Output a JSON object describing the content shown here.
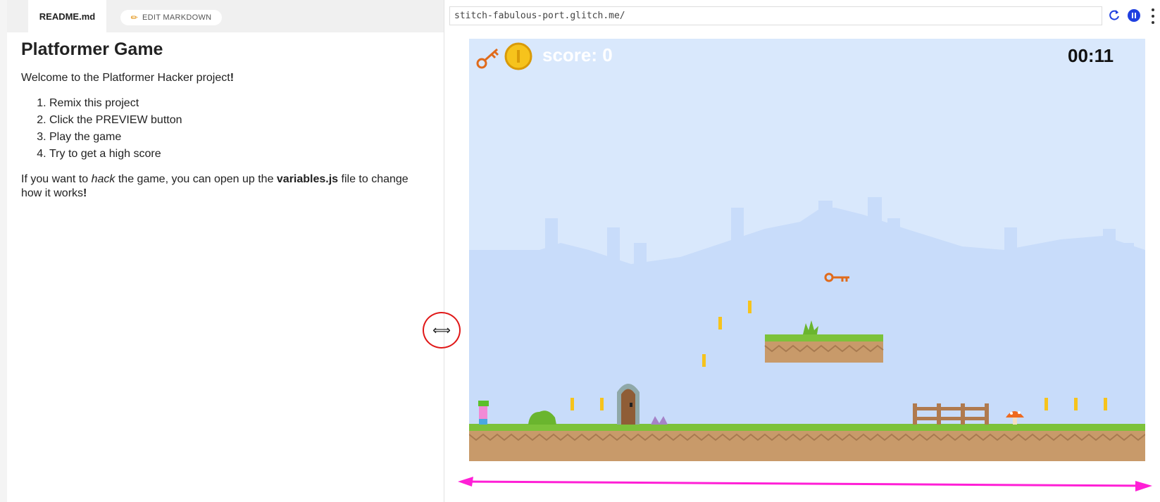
{
  "readme": {
    "tab_label": "README.md",
    "edit_button": "EDIT MARKDOWN",
    "edit_icon": "pencil-icon",
    "title": "Platformer Game",
    "intro_pre": "Welcome to the Platformer Hacker project",
    "intro_bang": "!",
    "steps": [
      "Remix this project",
      "Click the PREVIEW button",
      "Play the game",
      "Try to get a high score"
    ],
    "note_pre": "If you want to ",
    "note_em": "hack",
    "note_mid": " the game, you can open up the ",
    "note_strong": "variables.js",
    "note_post": " file to change how it works",
    "note_bang": "!"
  },
  "preview": {
    "url": "stitch-fabulous-port.glitch.me/",
    "reload_icon": "reload-icon",
    "pause_icon": "pause-icon",
    "more_icon": "more-vertical-icon"
  },
  "game": {
    "score_text": "score: 0",
    "timer": "00:11",
    "colors": {
      "sky": "#d9e8fc",
      "hills": "#c8dcfa",
      "grass": "#7cc23a",
      "dirt": "#c89a6a",
      "coin": "#f6c31c",
      "key": "#e06b1c"
    }
  },
  "annotations": {
    "resize_cursor": "resize-horizontal-icon",
    "circle_color": "#e01818",
    "arrow_color": "#ff1fd6"
  }
}
